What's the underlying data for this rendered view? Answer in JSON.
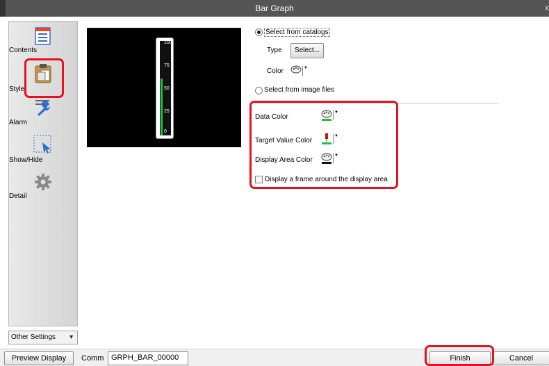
{
  "window": {
    "title": "Bar Graph",
    "close_glyph": "x"
  },
  "sidebar": {
    "items": [
      {
        "label": "Contents",
        "icon": "contents-icon"
      },
      {
        "label": "Style",
        "icon": "clipboard-icon"
      },
      {
        "label": "Alarm",
        "icon": "wrench-icon"
      },
      {
        "label": "Show/Hide",
        "icon": "selection-cursor-icon"
      },
      {
        "label": "Detail",
        "icon": "gear-icon"
      }
    ],
    "other_settings": "Other Settings"
  },
  "preview": {
    "scale_labels": [
      "100",
      "75",
      "50",
      "25",
      "0"
    ],
    "fill_fraction": 0.6,
    "fill_color": "#22c23a"
  },
  "style": {
    "select_from_catalogs": "Select from catalogs",
    "type_label": "Type",
    "select_button": "Select...",
    "color_label": "Color",
    "select_from_image_files": "Select from image files",
    "data_color_label": "Data Color",
    "target_value_color_label": "Target Value Color",
    "display_area_color_label": "Display Area Color",
    "frame_checkbox_label": "Display a frame around the display area"
  },
  "bottom": {
    "preview_display": "Preview Display",
    "comm_label": "Comm",
    "comm_value": "GRPH_BAR_00000",
    "finish": "Finish",
    "cancel": "Cancel"
  },
  "colors": {
    "highlight": "#e8101e",
    "titlebar": "#555555"
  }
}
